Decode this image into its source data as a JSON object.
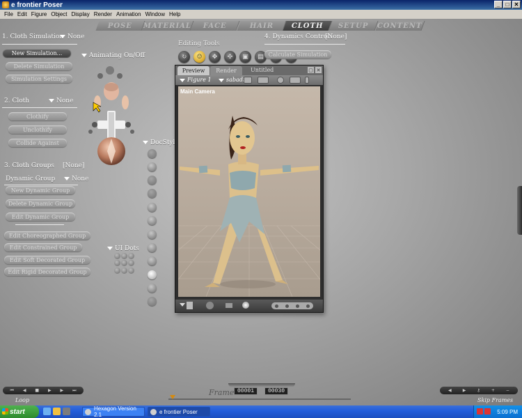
{
  "window": {
    "title": "e frontier Poser"
  },
  "menu": [
    "File",
    "Edit",
    "Figure",
    "Object",
    "Display",
    "Render",
    "Animation",
    "Window",
    "Help"
  ],
  "rooms": [
    {
      "label": "POSE",
      "active": false
    },
    {
      "label": "MATERIAL",
      "active": false
    },
    {
      "label": "FACE",
      "active": false
    },
    {
      "label": "HAIR",
      "active": false
    },
    {
      "label": "CLOTH",
      "active": true
    },
    {
      "label": "SETUP",
      "active": false
    },
    {
      "label": "CONTENT",
      "active": false
    }
  ],
  "cloth_panel": {
    "section1": {
      "title": "1. Cloth Simulation",
      "value": "None"
    },
    "sim_buttons": [
      "New Simulation...",
      "Delete Simulation",
      "Simulation Settings"
    ],
    "section2": {
      "title": "2. Cloth",
      "value": "None"
    },
    "cloth_buttons": [
      "Clothify",
      "Unclothify",
      "Collide Against"
    ],
    "section3": {
      "title": "3. Cloth Groups",
      "value": "[None]"
    },
    "dynamic_group": {
      "label": "Dynamic Group",
      "value": "None"
    },
    "group_buttons": [
      "New Dynamic Group",
      "Delete Dynamic Group",
      "Edit Dynamic Group"
    ],
    "decorated_buttons": [
      "Edit Choreographed Group",
      "Edit Constrained Group",
      "Edit Soft Decorated Group",
      "Edit Rigid Decorated Group"
    ],
    "section4": {
      "title": "4. Dynamics Controls",
      "value": "[None]"
    },
    "dynamics_buttons": [
      "Calculate Simulation"
    ]
  },
  "animating_label": "Animating On/Off",
  "docstyle_label": "DocStyle",
  "uidots_label": "UI Dots",
  "editing_tools_label": "Editing Tools",
  "document": {
    "tabs": [
      "Preview",
      "Render"
    ],
    "title": "Untitled",
    "figure_menu": "Figure 1",
    "actor_menu": "sabadi",
    "camera_label": "Main Camera"
  },
  "timeline": {
    "frame_label": "Frame",
    "current_frame": "00001",
    "total_frames": "00030",
    "loop_label": "Loop",
    "skip_label": "Skip Frames"
  },
  "taskbar": {
    "start": "start",
    "items": [
      {
        "label": "Hexagon Version 2.1",
        "active": false
      },
      {
        "label": "e frontier Poser",
        "active": true
      }
    ],
    "clock": "5:09 PM"
  },
  "colors": {
    "active_tab": "#3c3c3c",
    "accent_tool": "#d6a62a",
    "taskbar": "#245edb"
  }
}
